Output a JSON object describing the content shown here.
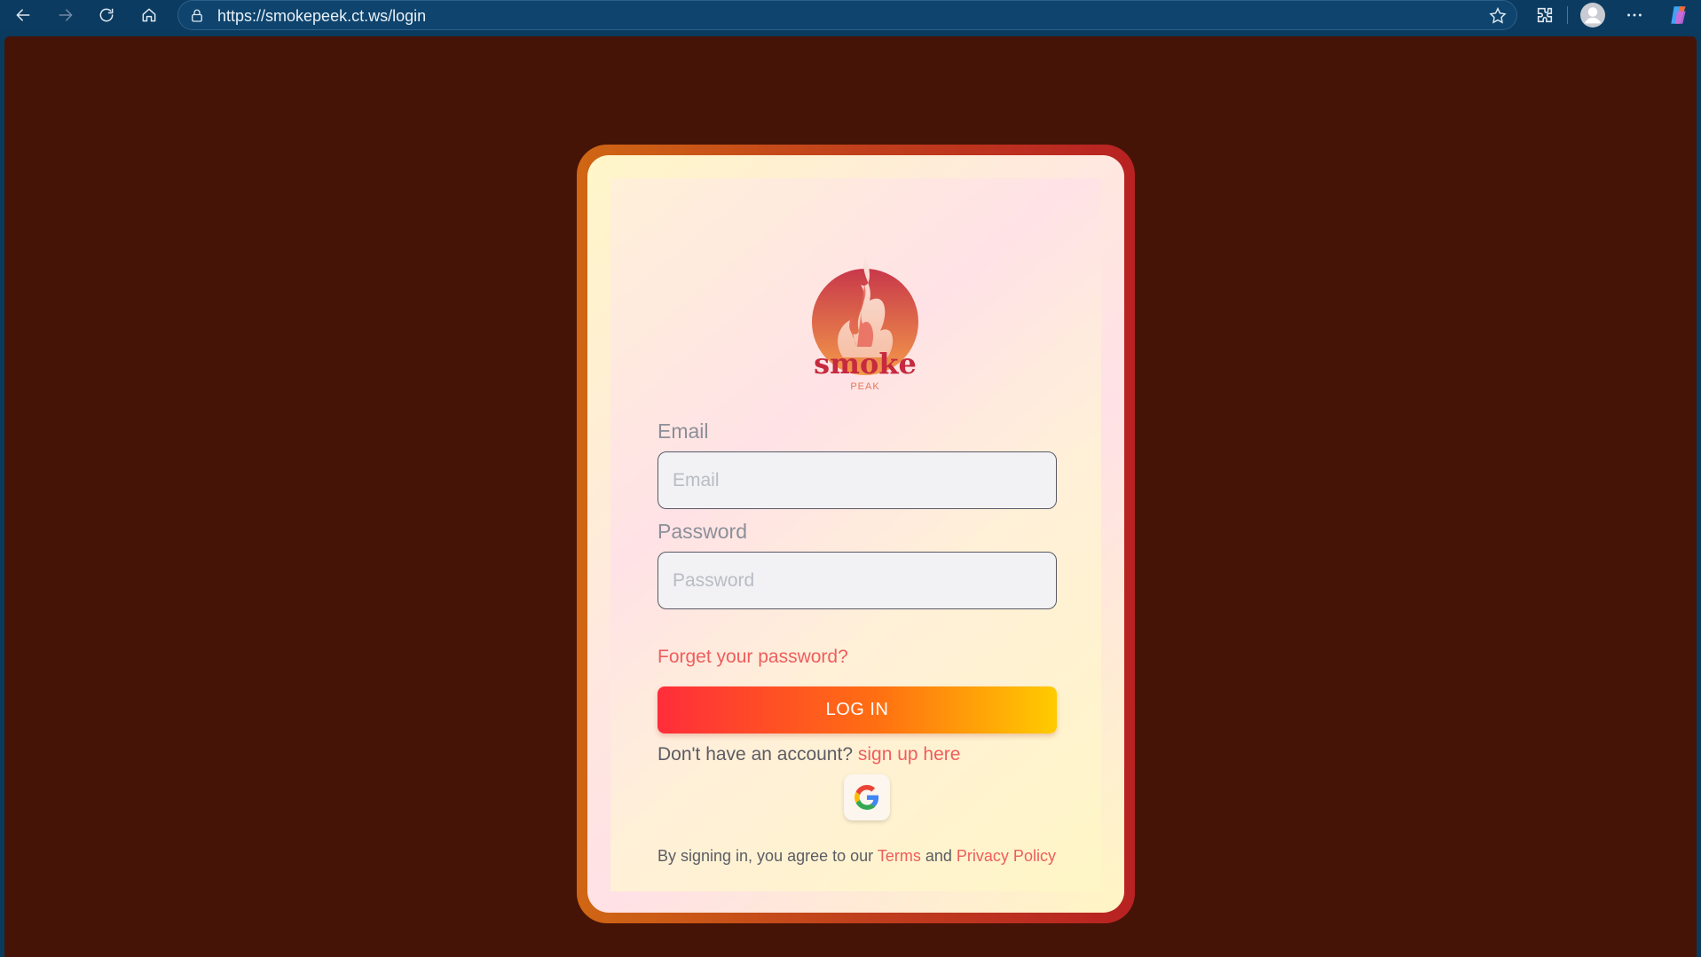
{
  "browser": {
    "url": "https://smokepeek.ct.ws/login",
    "icons": [
      "back-icon",
      "forward-icon",
      "refresh-icon",
      "home-icon",
      "lock-icon",
      "favorite-star-icon",
      "extensions-icon",
      "profile-icon",
      "more-icon",
      "copilot-icon"
    ]
  },
  "login": {
    "logo_text": "smoke",
    "logo_subtext": "PEAK",
    "email_label": "Email",
    "email_placeholder": "Email",
    "email_value": "",
    "password_label": "Password",
    "password_placeholder": "Password",
    "password_value": "",
    "forgot_link": "Forget your password?",
    "login_button": "LOG IN",
    "signup_prompt": "Don't have an account?",
    "signup_link": "sign up here",
    "terms_prefix": "By signing in, you agree to our",
    "terms_link": "Terms",
    "terms_and": "and",
    "privacy_link": "Privacy Policy"
  },
  "colors": {
    "page_background": "#461406",
    "accent_link": "#ef5d5d",
    "button_gradient_start": "#ff2d3a",
    "button_gradient_end": "#ffcb00",
    "frame_orange": "#d06614",
    "frame_red": "#b82222"
  }
}
